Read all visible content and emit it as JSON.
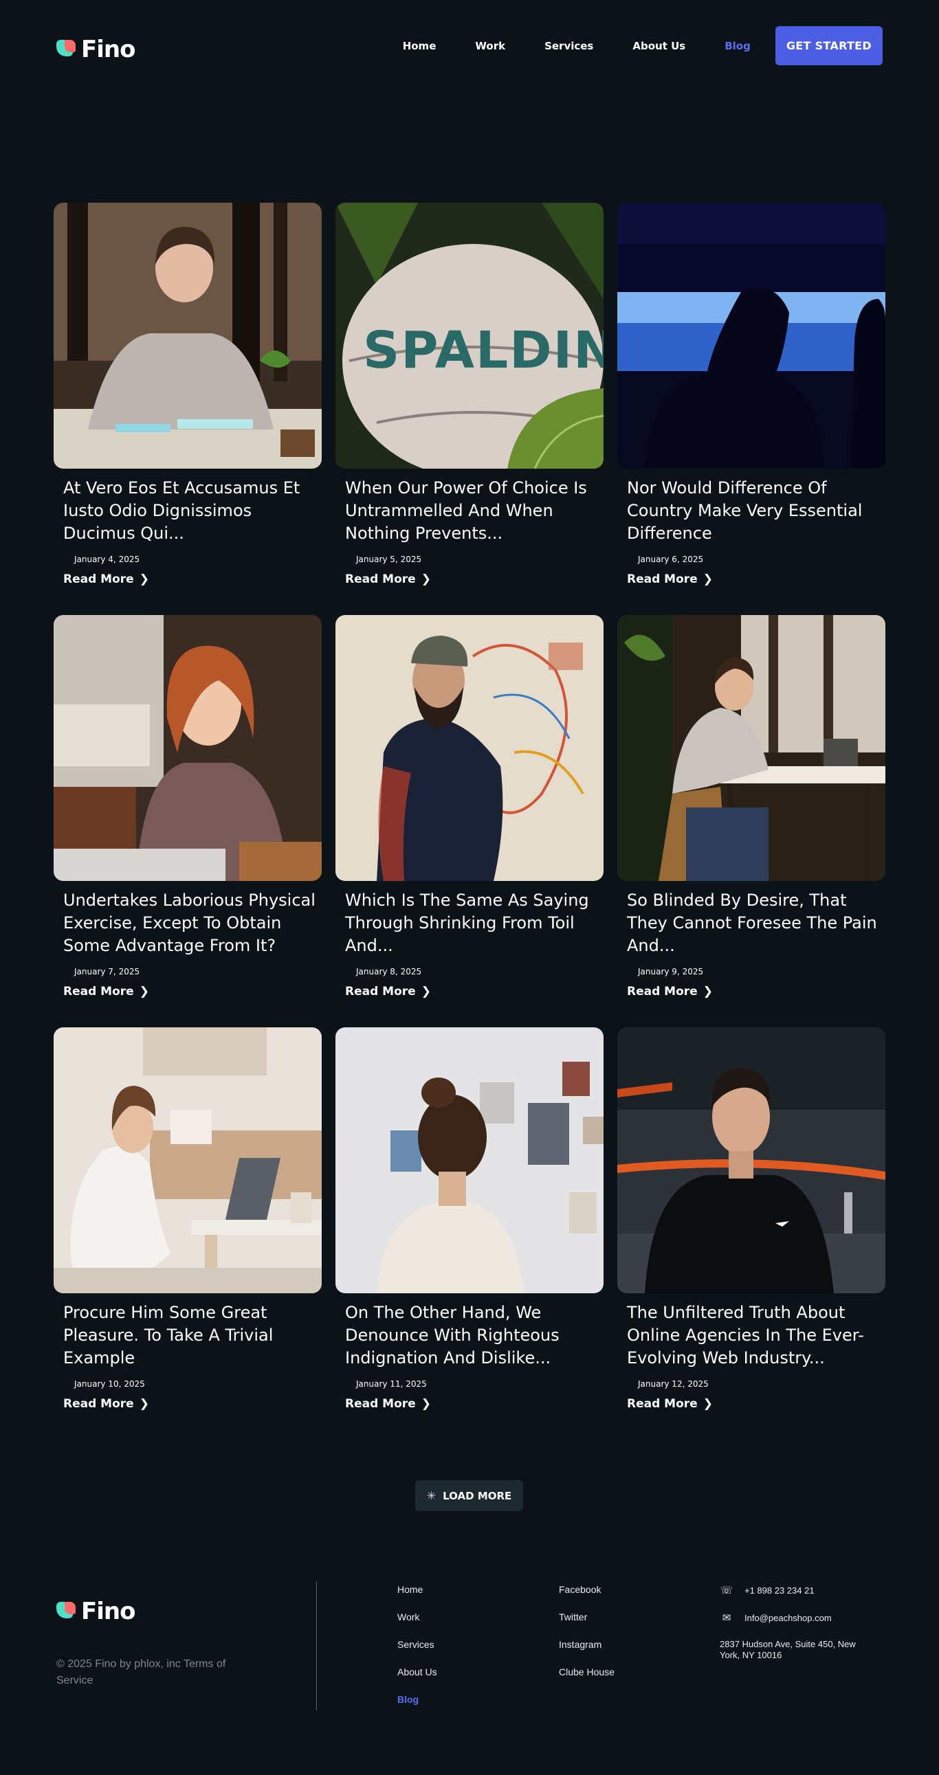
{
  "brand": {
    "name": "Fino"
  },
  "nav": {
    "items": [
      {
        "label": "Home"
      },
      {
        "label": "Work"
      },
      {
        "label": "Services"
      },
      {
        "label": "About Us"
      },
      {
        "label": "Blog",
        "active": true
      }
    ],
    "cta_label": "GET STARTED"
  },
  "posts": [
    {
      "title": "At Vero Eos Et Accusamus Et Iusto Odio Dignissimos Ducimus Qui...",
      "date": "January 4, 2025",
      "read_more": "Read More",
      "image": "woman-drawing-at-desk"
    },
    {
      "title": "When Our Power Of Choice Is Untrammelled And When Nothing Prevents...",
      "date": "January 5, 2025",
      "read_more": "Read More",
      "image": "spalding-basketball-in-leaves"
    },
    {
      "title": "Nor Would Difference Of Country Make Very Essential Difference",
      "date": "January 6, 2025",
      "read_more": "Read More",
      "image": "silhouettes-by-window"
    },
    {
      "title": "Undertakes Laborious Physical Exercise, Except To Obtain Some Advantage From It?",
      "date": "January 7, 2025",
      "read_more": "Read More",
      "image": "smiling-woman-with-laptop"
    },
    {
      "title": "Which Is The Same As Saying Through Shrinking From Toil And...",
      "date": "January 8, 2025",
      "read_more": "Read More",
      "image": "bearded-man-painting-mural"
    },
    {
      "title": "So Blinded By Desire, That They Cannot Foresee The Pain And...",
      "date": "January 9, 2025",
      "read_more": "Read More",
      "image": "woman-writing-at-table"
    },
    {
      "title": "Procure Him Some Great Pleasure. To Take A Trivial Example",
      "date": "January 10, 2025",
      "read_more": "Read More",
      "image": "woman-on-floor-with-laptop"
    },
    {
      "title": "On The Other Hand, We Denounce With Righteous Indignation And Dislike...",
      "date": "January 11, 2025",
      "read_more": "Read More",
      "image": "woman-viewing-photo-wall"
    },
    {
      "title": "The Unfiltered Truth About Online Agencies In The Ever-Evolving Web Industry...",
      "date": "January 12, 2025",
      "read_more": "Read More",
      "image": "man-in-black-tshirt"
    }
  ],
  "load_more": {
    "label": "LOAD MORE"
  },
  "footer": {
    "copyright": "© 2025 Fino by phlox, inc Terms of Service",
    "nav_links": [
      "Home",
      "Work",
      "Services",
      "About Us",
      "Blog"
    ],
    "social_links": [
      "Facebook",
      "Twitter",
      "Instagram",
      "Clube House"
    ],
    "contact": {
      "phone": "+1 898 23 234 21",
      "email": "Info@peachshop.com",
      "address": "2837 Hudson Ave, Suite 450, New York, NY 10016"
    }
  },
  "colors": {
    "background": "#0c1318",
    "accent": "#4c5ee3",
    "active_link": "#5a6ef0"
  }
}
